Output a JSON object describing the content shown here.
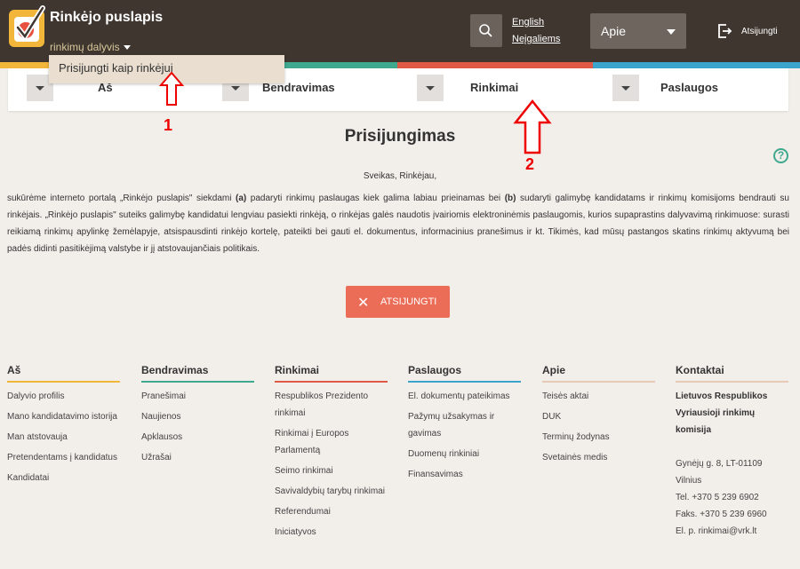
{
  "header": {
    "site_title": "Rinkėjo puslapis",
    "role": "rinkimų dalyvis",
    "lang_english": "English",
    "lang_disabled": "Neįgaliems",
    "about_select": "Apie",
    "logout": "Atsijungti"
  },
  "dropdown": {
    "item": "Prisijungti kaip rinkėjui"
  },
  "nav": {
    "items": [
      {
        "label": "Aš"
      },
      {
        "label": "Bendravimas"
      },
      {
        "label": "Rinkimai"
      },
      {
        "label": "Paslaugos"
      }
    ]
  },
  "annotations": {
    "one": "1",
    "two": "2"
  },
  "main": {
    "title": "Prisijungimas",
    "greeting": "Sveikas, Rinkėjau,",
    "intro_1": "sukūrėme interneto portalą „Rinkėjo puslapis\" siekdami ",
    "intro_a": "(a)",
    "intro_2": " padaryti rinkimų paslaugas kiek galima labiau prieinamas bei ",
    "intro_b": "(b)",
    "intro_3": " sudaryti galimybę kandidatams ir rinkimų komisijoms bendrauti su rinkėjais. „Rinkėjo puslapis\" suteiks galimybę kandidatui lengviau pasiekti rinkėją, o rinkėjas galės naudotis įvairiomis elektroninėmis paslaugomis, kurios supaprastins dalyvavimą rinkimuose: surasti reikiamą rinkimų apylinkę žemėlapyje, atsispausdinti rinkėjo kortelę, pateikti bei gauti el. dokumentus, informacinius pranešimus ir kt. Tikimės, kad mūsų pastangos skatins rinkimų aktyvumą bei padės didinti pasitikėjimą valstybe ir jį atstovaujančiais politikais.",
    "logout_button": "ATSIJUNGTI"
  },
  "footer": {
    "columns": [
      {
        "title": "Aš",
        "links": [
          "Dalyvio profilis",
          "Mano kandidatavimo istorija",
          "Man atstovauja",
          "Pretendentams į kandidatus",
          "Kandidatai"
        ]
      },
      {
        "title": "Bendravimas",
        "links": [
          "Pranešimai",
          "Naujienos",
          "Apklausos",
          "Užrašai"
        ]
      },
      {
        "title": "Rinkimai",
        "links": [
          "Respublikos Prezidento rinkimai",
          "Rinkimai į Europos Parlamentą",
          "Seimo rinkimai",
          "Savivaldybių tarybų rinkimai",
          "Referendumai",
          "Iniciatyvos"
        ]
      },
      {
        "title": "Paslaugos",
        "links": [
          "El. dokumentų pateikimas",
          "Pažymų užsakymas ir gavimas",
          "Duomenų rinkiniai",
          "Finansavimas"
        ]
      },
      {
        "title": "Apie",
        "links": [
          "Teisės aktai",
          "DUK",
          "Terminų žodynas",
          "Svetainės medis"
        ]
      }
    ],
    "contact": {
      "title": "Kontaktai",
      "org": "Lietuvos Respublikos Vyriausioji rinkimų komisija",
      "address": "Gynėjų g. 8, LT-01109 Vilnius",
      "phone": "Tel. +370 5 239 6902",
      "fax": "Faks. +370 5 239 6960",
      "email": "El. p. rinkimai@vrk.lt"
    }
  },
  "colors": {
    "header_bg": "#3f3630",
    "stripe_1": "#f1b63a",
    "stripe_2": "#3fa98f",
    "stripe_3": "#de5a46",
    "stripe_4": "#3aa4cc",
    "logout_button": "#ec6d57",
    "annotation": "#e00000"
  }
}
